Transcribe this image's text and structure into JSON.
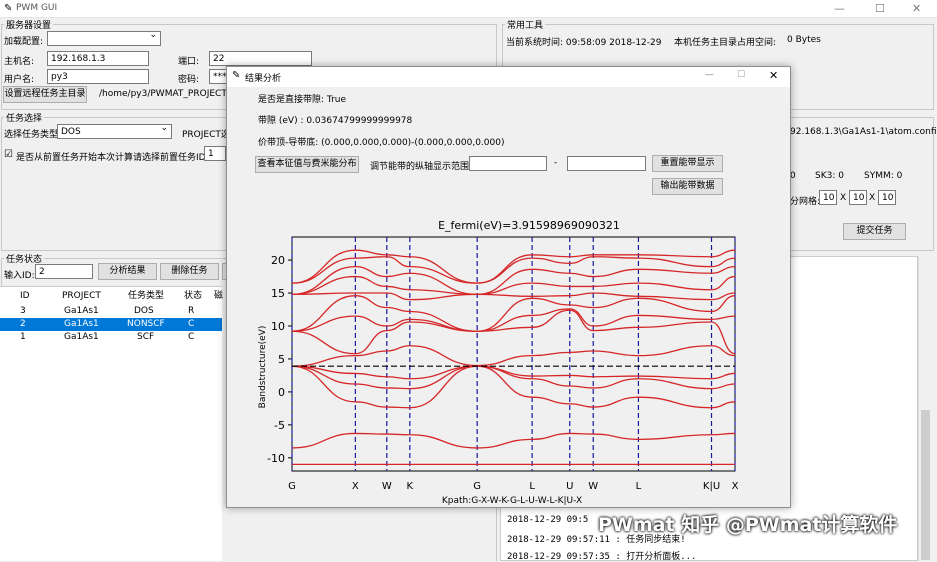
{
  "window": {
    "title": "PWM GUI",
    "minimize": "—",
    "maximize": "☐",
    "close": "✕"
  },
  "server": {
    "legend": "服务器设置",
    "load_config_label": "加载配置:",
    "host_label": "主机名:",
    "host_value": "192.168.1.3",
    "port_label": "端口:",
    "port_value": "22",
    "user_label": "用户名:",
    "user_value": "py3",
    "password_label": "密码:",
    "password_value": "****",
    "set_dir_button": "设置远程任务主目录",
    "remote_dir": "/home/py3/PWMAT_PROJECT"
  },
  "tools": {
    "legend": "常用工具",
    "time_label": "当前系统时间: 09:58:09 2018-12-29",
    "space_label": "本机任务主目录占用空间:",
    "space_value": "0 Bytes"
  },
  "task_select": {
    "legend": "任务选择",
    "type_label": "选择任务类型:",
    "type_value": "DOS",
    "project_label": "PROJECT选",
    "continue_label": "是否从前置任务开始本次计算",
    "prev_id_label": "请选择前置任务ID:",
    "prev_id_value": "1",
    "config_path": "92.168.1.3\\Ga1As1-1\\atom.config",
    "sk3_label": "SK3: 0",
    "symm_label": "SYMM: 0",
    "grid_prefix": "0",
    "grid_label": "分网格:",
    "grid_values": [
      "10",
      "10",
      "10"
    ],
    "grid_sep": "X",
    "submit_button": "提交任务"
  },
  "task_status": {
    "legend": "任务状态",
    "input_id_label": "输入ID:",
    "input_id_value": "2",
    "analyze_button": "分析结果",
    "delete_button": "删除任务",
    "columns": [
      "ID",
      "PROJECT",
      "任务类型",
      "状态",
      "磁"
    ],
    "rows": [
      {
        "id": "3",
        "project": "Ga1As1",
        "type": "DOS",
        "state": "R",
        "extra": ""
      },
      {
        "id": "2",
        "project": "Ga1As1",
        "type": "NONSCF",
        "state": "C",
        "extra": ""
      },
      {
        "id": "1",
        "project": "Ga1As1",
        "type": "SCF",
        "state": "C",
        "extra": ""
      }
    ]
  },
  "log": {
    "lines": [
      "2018-12-29 09:5",
      "2018-12-29 09:57:11 : 任务同步结束!",
      "2018-12-29 09:57:35 : 打开分析面板..."
    ]
  },
  "watermark": "PWmat 知乎 @PWmat计算软件",
  "dialog": {
    "title": "结果分析",
    "minimize": "—",
    "maximize": "☐",
    "close": "✕",
    "direct_gap": "是否是直接带隙: True",
    "gap": "带隙 (eV) : 0.03674799999999978",
    "vbm_cbm": "价带顶-导带底: (0.000,0.000,0.000)-(0.000,0.000,0.000)",
    "view_eig_button": "查看本征值与费米能分布",
    "range_label": "调节能带的纵轴显示范围:",
    "range_sep": "-",
    "reset_button": "重置能带显示",
    "export_button": "输出能带数据"
  },
  "chart_data": {
    "type": "line",
    "title": "E_fermi(eV)=3.91598969090321",
    "xlabel": "Kpath:G-X-W-K-G-L-U-W-L-K|U-X",
    "ylabel": "Bandstructure(eV)",
    "ylim": [
      -12,
      23.5
    ],
    "yticks": [
      -10,
      -5,
      0,
      5,
      10,
      15,
      20
    ],
    "xlim": [
      0,
      1
    ],
    "kpoints": [
      {
        "label": "G",
        "x": 0.0
      },
      {
        "label": "X",
        "x": 0.143
      },
      {
        "label": "W",
        "x": 0.214
      },
      {
        "label": "K",
        "x": 0.266
      },
      {
        "label": "G",
        "x": 0.418
      },
      {
        "label": "L",
        "x": 0.542
      },
      {
        "label": "U",
        "x": 0.627
      },
      {
        "label": "W",
        "x": 0.68
      },
      {
        "label": "L",
        "x": 0.782
      },
      {
        "label": "K|U",
        "x": 0.947
      },
      {
        "label": "X",
        "x": 1.0
      }
    ],
    "fermi_line": 3.9,
    "grid": false,
    "line_color": "#d62728",
    "kline_color": "#1a1a9e",
    "series": [
      {
        "y": [
          -11.0,
          -11.0,
          -11.0,
          -11.0,
          -11.0,
          -11.0,
          -11.0,
          -11.0,
          -11.0,
          -11.0,
          -11.0
        ]
      },
      {
        "y": [
          -8.5,
          -6.3,
          -6.4,
          -6.5,
          -8.5,
          -7.2,
          -6.3,
          -6.4,
          -7.2,
          -6.5,
          -6.3
        ]
      },
      {
        "y": [
          3.9,
          -1.5,
          -2.3,
          -2.4,
          3.9,
          -0.8,
          -1.8,
          -2.3,
          -0.8,
          -2.4,
          -1.5
        ]
      },
      {
        "y": [
          3.9,
          1.2,
          0.6,
          0.5,
          3.9,
          2.0,
          0.9,
          0.6,
          2.0,
          0.5,
          1.2
        ]
      },
      {
        "y": [
          3.9,
          2.8,
          2.3,
          2.0,
          3.9,
          2.4,
          2.5,
          2.3,
          2.4,
          2.0,
          2.8
        ]
      },
      {
        "y": [
          3.9,
          5.5,
          6.2,
          7.0,
          4.0,
          5.5,
          6.0,
          6.2,
          5.5,
          7.0,
          5.5
        ]
      },
      {
        "y": [
          9.2,
          5.8,
          9.3,
          10.6,
          9.2,
          9.8,
          12.4,
          9.3,
          9.8,
          10.6,
          5.8
        ]
      },
      {
        "y": [
          9.2,
          11.5,
          10.0,
          11.0,
          9.2,
          11.6,
          12.6,
          10.0,
          11.6,
          11.0,
          11.5
        ]
      },
      {
        "y": [
          9.2,
          14.6,
          12.8,
          12.2,
          9.2,
          14.2,
          13.2,
          12.8,
          14.2,
          12.2,
          14.6
        ]
      },
      {
        "y": [
          14.8,
          15.0,
          15.0,
          14.0,
          14.8,
          14.5,
          14.6,
          15.0,
          14.5,
          14.0,
          15.0
        ]
      },
      {
        "y": [
          14.8,
          17.5,
          16.0,
          15.5,
          14.8,
          16.5,
          16.0,
          16.0,
          16.5,
          15.5,
          17.5
        ]
      },
      {
        "y": [
          14.8,
          19.0,
          17.5,
          18.0,
          14.8,
          18.6,
          18.0,
          17.5,
          18.6,
          18.0,
          19.0
        ]
      },
      {
        "y": [
          16.5,
          20.3,
          20.5,
          19.0,
          16.5,
          20.3,
          19.5,
          20.5,
          20.3,
          19.0,
          20.3
        ]
      },
      {
        "y": [
          16.5,
          21.5,
          20.8,
          20.5,
          16.5,
          20.8,
          20.5,
          20.8,
          20.8,
          20.5,
          21.5
        ]
      }
    ]
  }
}
